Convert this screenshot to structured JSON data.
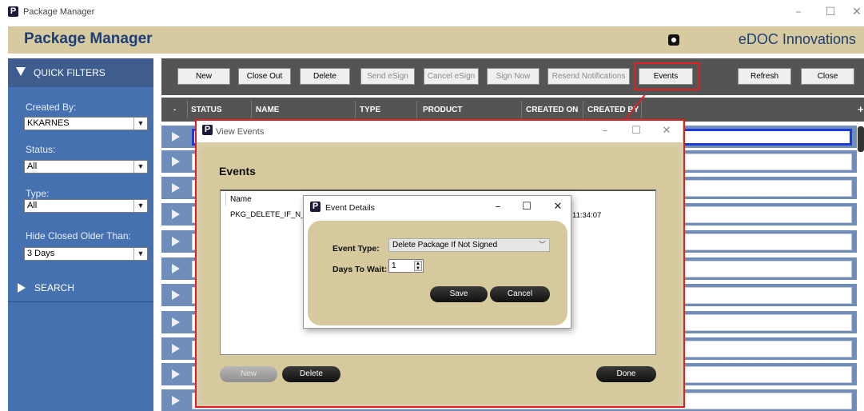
{
  "window": {
    "title": "Package Manager",
    "controls": {
      "minimize": "–",
      "maximize": "☐",
      "close": "✕"
    }
  },
  "header": {
    "title": "Package Manager",
    "brand": "eDOC Innovations"
  },
  "sidebar": {
    "quick_filters": "QUICK FILTERS",
    "created_by": {
      "label": "Created By:",
      "value": "KKARNES"
    },
    "status": {
      "label": "Status:",
      "value": "All"
    },
    "type": {
      "label": "Type:",
      "value": "All"
    },
    "hide_closed": {
      "label": "Hide Closed Older Than:",
      "value": "3 Days"
    },
    "search": "SEARCH"
  },
  "toolbar": {
    "new": "New",
    "close_out": "Close Out",
    "delete": "Delete",
    "send_esign": "Send eSign",
    "cancel_esign": "Cancel eSign",
    "sign_now": "Sign Now",
    "resend": "Resend Notifications",
    "events": "Events",
    "refresh": "Refresh",
    "close": "Close"
  },
  "columns": {
    "status": "STATUS",
    "name": "NAME",
    "type": "TYPE",
    "product": "PRODUCT",
    "created_on": "CREATED ON",
    "created_by": "CREATED BY",
    "minus": "-",
    "plus": "+"
  },
  "view_events": {
    "title": "View Events",
    "heading": "Events",
    "list_column": "Name",
    "item_name": "PKG_DELETE_IF_N_S",
    "item_time": "11:34:07",
    "buttons": {
      "new": "New",
      "delete": "Delete",
      "done": "Done"
    }
  },
  "event_details": {
    "title": "Event Details",
    "event_type_label": "Event Type:",
    "event_type_value": "Delete Package If Not Signed",
    "days_label": "Days To Wait:",
    "days_value": "1",
    "save": "Save",
    "cancel": "Cancel"
  },
  "colors": {
    "accent_blue": "#1d3f75",
    "sidebar": "#4671b0",
    "tan": "#d8caa0",
    "highlight": "#e02020"
  }
}
